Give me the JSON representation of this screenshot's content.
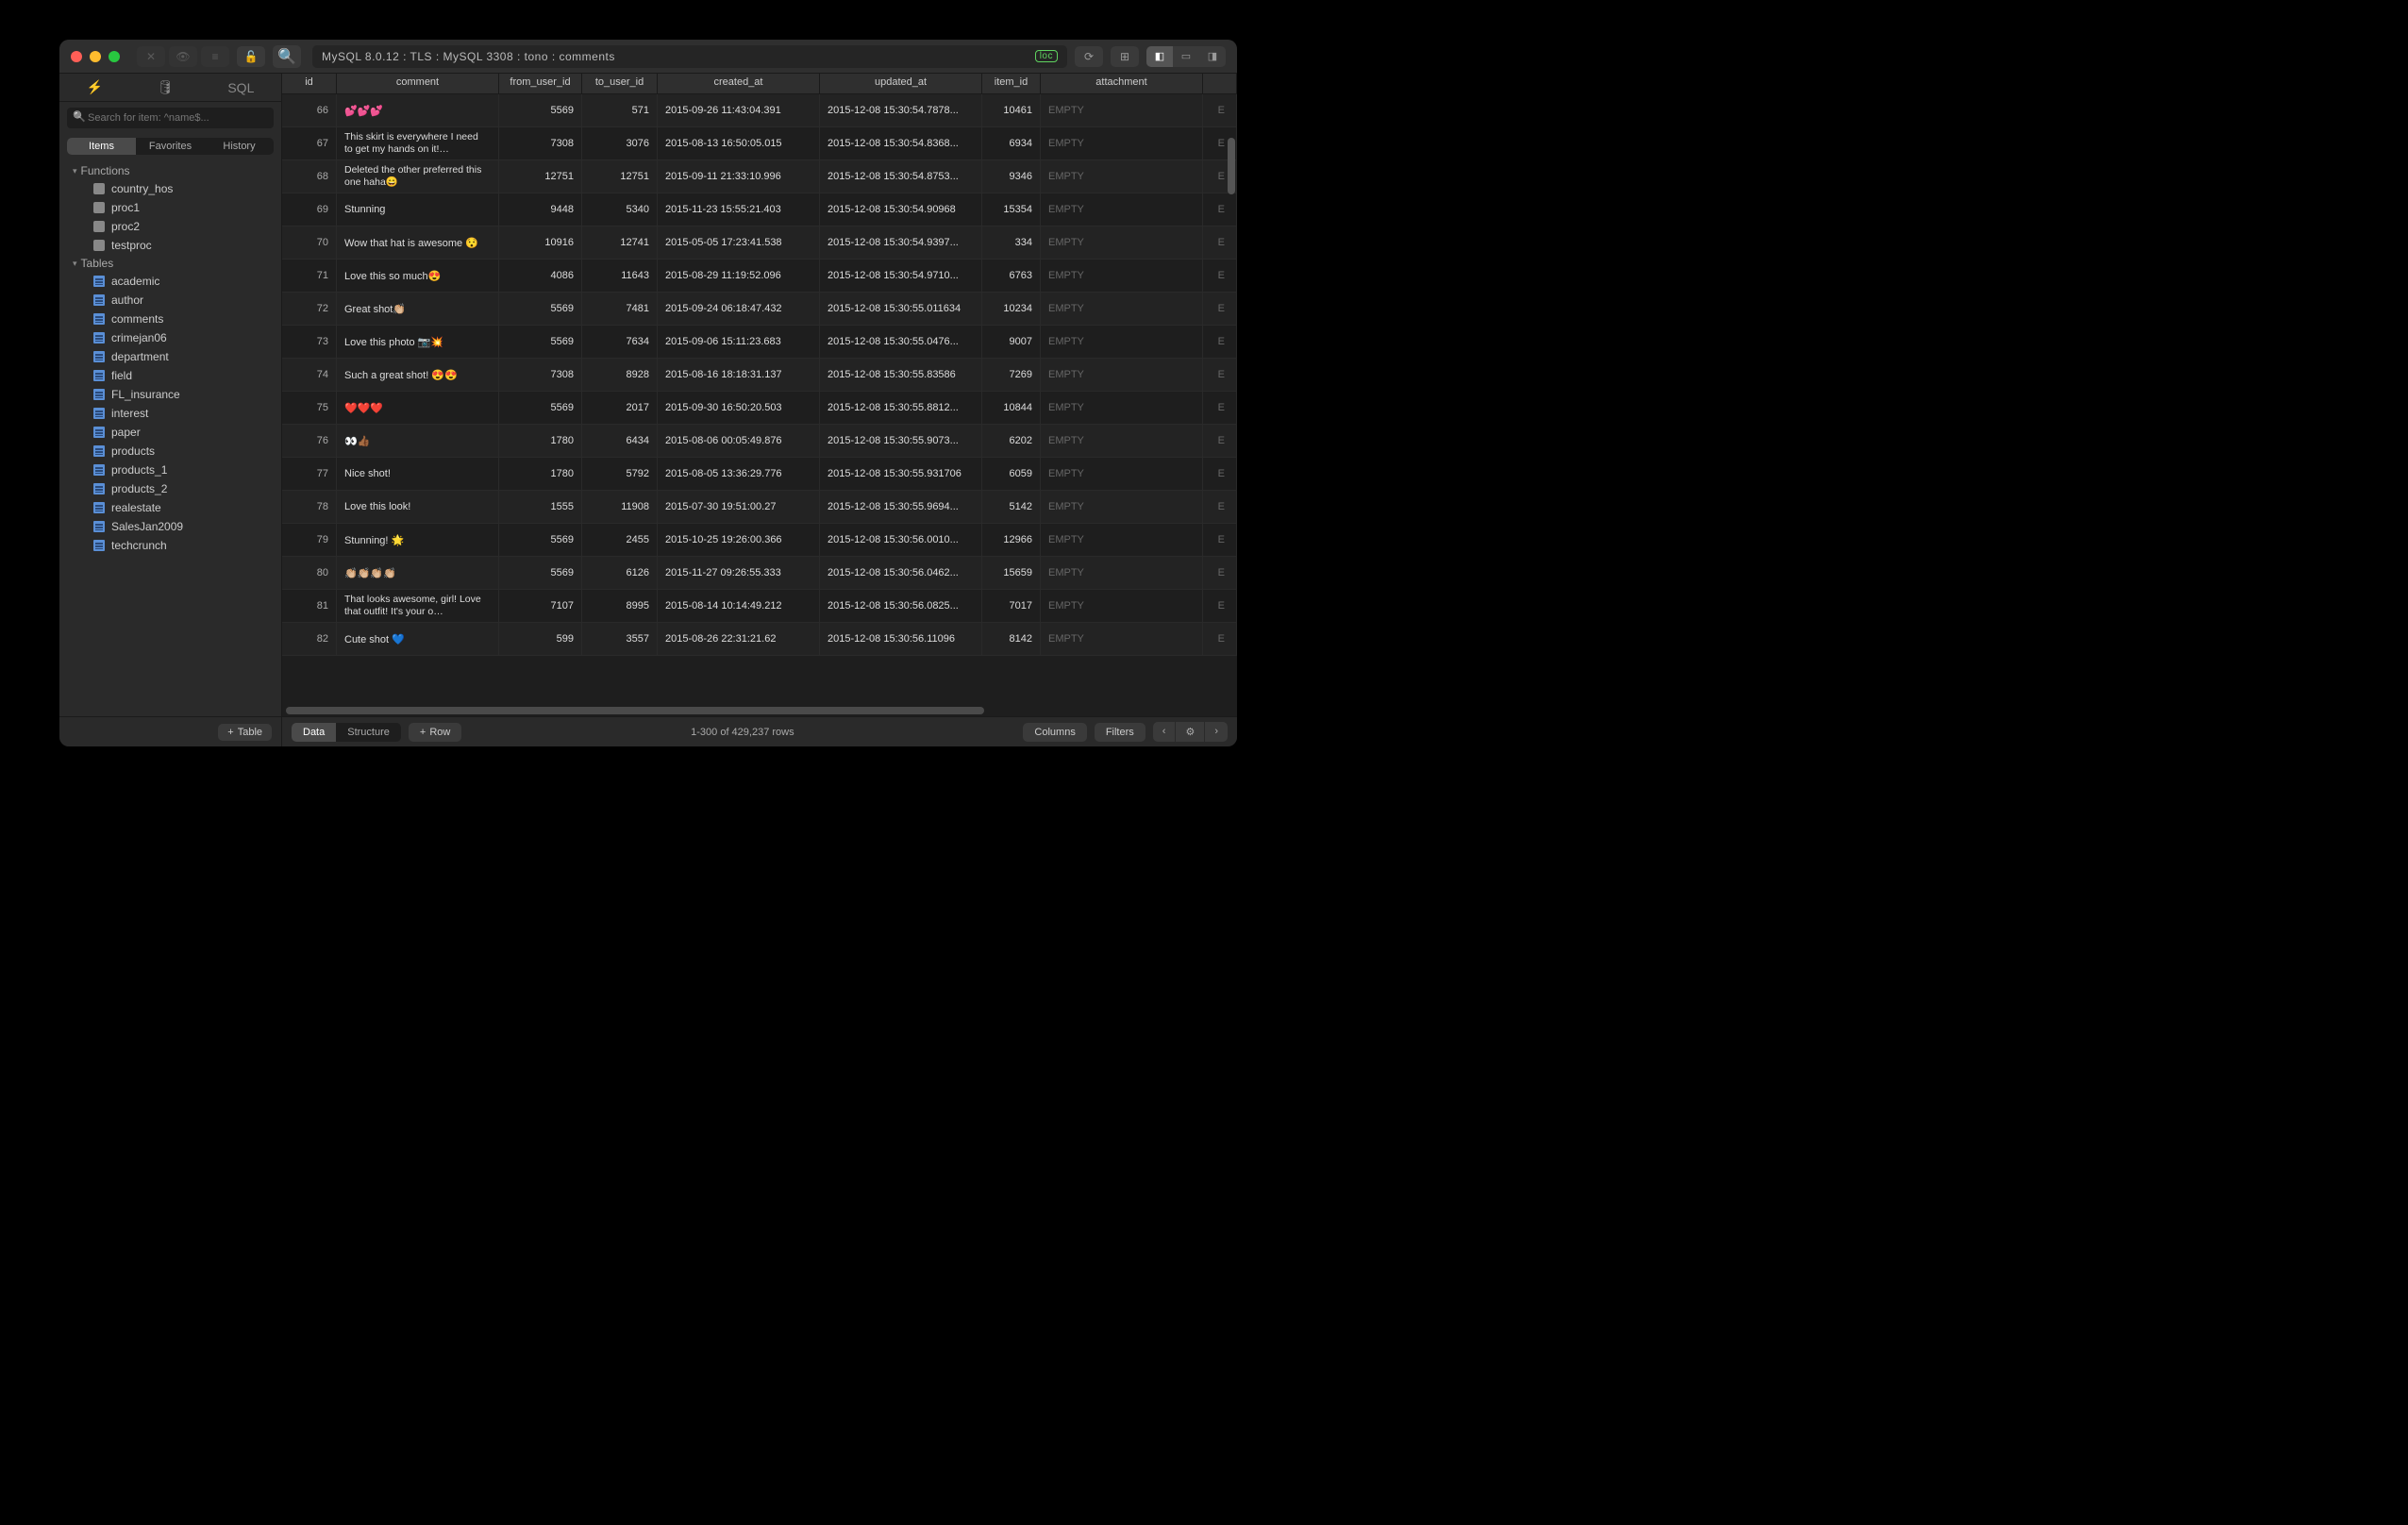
{
  "breadcrumb": "MySQL 8.0.12 : TLS : MySQL 3308 : tono : comments",
  "loc_badge": "loc",
  "search_placeholder": "Search for item: ^name$...",
  "segments": {
    "items": "Items",
    "favorites": "Favorites",
    "history": "History"
  },
  "tree": {
    "functions_label": "Functions",
    "functions": [
      "country_hos",
      "proc1",
      "proc2",
      "testproc"
    ],
    "tables_label": "Tables",
    "tables": [
      "academic",
      "author",
      "comments",
      "crimejan06",
      "department",
      "field",
      "FL_insurance",
      "interest",
      "paper",
      "products",
      "products_1",
      "products_2",
      "realestate",
      "SalesJan2009",
      "techcrunch"
    ]
  },
  "add_table_label": "Table",
  "columns": [
    "id",
    "comment",
    "from_user_id",
    "to_user_id",
    "created_at",
    "updated_at",
    "item_id",
    "attachment"
  ],
  "empty_label": "EMPTY",
  "rows": [
    {
      "id": "66",
      "comment": "💕💕💕",
      "from": "5569",
      "to": "571",
      "created": "2015-09-26 11:43:04.391",
      "updated": "2015-12-08 15:30:54.7878...",
      "item": "10461"
    },
    {
      "id": "67",
      "comment": "This skirt is everywhere I need to get my hands on it!…",
      "from": "7308",
      "to": "3076",
      "created": "2015-08-13 16:50:05.015",
      "updated": "2015-12-08 15:30:54.8368...",
      "item": "6934",
      "multi": true
    },
    {
      "id": "68",
      "comment": "Deleted the other preferred this one haha😄",
      "from": "12751",
      "to": "12751",
      "created": "2015-09-11 21:33:10.996",
      "updated": "2015-12-08 15:30:54.8753...",
      "item": "9346",
      "multi": true
    },
    {
      "id": "69",
      "comment": "Stunning",
      "from": "9448",
      "to": "5340",
      "created": "2015-11-23 15:55:21.403",
      "updated": "2015-12-08 15:30:54.90968",
      "item": "15354"
    },
    {
      "id": "70",
      "comment": "Wow that hat is awesome 😯",
      "from": "10916",
      "to": "12741",
      "created": "2015-05-05 17:23:41.538",
      "updated": "2015-12-08 15:30:54.9397...",
      "item": "334"
    },
    {
      "id": "71",
      "comment": " Love this so much😍",
      "from": "4086",
      "to": "11643",
      "created": "2015-08-29 11:19:52.096",
      "updated": "2015-12-08 15:30:54.9710...",
      "item": "6763"
    },
    {
      "id": "72",
      "comment": "Great shot👏🏼",
      "from": "5569",
      "to": "7481",
      "created": "2015-09-24 06:18:47.432",
      "updated": "2015-12-08 15:30:55.011634",
      "item": "10234"
    },
    {
      "id": "73",
      "comment": "Love this photo 📷💥",
      "from": "5569",
      "to": "7634",
      "created": "2015-09-06 15:11:23.683",
      "updated": "2015-12-08 15:30:55.0476...",
      "item": "9007"
    },
    {
      "id": "74",
      "comment": "Such a great shot! 😍😍",
      "from": "7308",
      "to": "8928",
      "created": "2015-08-16 18:18:31.137",
      "updated": "2015-12-08 15:30:55.83586",
      "item": "7269"
    },
    {
      "id": "75",
      "comment": "❤️❤️❤️",
      "from": "5569",
      "to": "2017",
      "created": "2015-09-30 16:50:20.503",
      "updated": "2015-12-08 15:30:55.8812...",
      "item": "10844"
    },
    {
      "id": "76",
      "comment": "👀👍🏾",
      "from": "1780",
      "to": "6434",
      "created": "2015-08-06 00:05:49.876",
      "updated": "2015-12-08 15:30:55.9073...",
      "item": "6202"
    },
    {
      "id": "77",
      "comment": "Nice shot!",
      "from": "1780",
      "to": "5792",
      "created": "2015-08-05 13:36:29.776",
      "updated": "2015-12-08 15:30:55.931706",
      "item": "6059"
    },
    {
      "id": "78",
      "comment": "Love this look!",
      "from": "1555",
      "to": "11908",
      "created": "2015-07-30 19:51:00.27",
      "updated": "2015-12-08 15:30:55.9694...",
      "item": "5142"
    },
    {
      "id": "79",
      "comment": "Stunning! 🌟",
      "from": "5569",
      "to": "2455",
      "created": "2015-10-25 19:26:00.366",
      "updated": "2015-12-08 15:30:56.0010...",
      "item": "12966"
    },
    {
      "id": "80",
      "comment": "👏🏼👏🏼👏🏼👏🏼",
      "from": "5569",
      "to": "6126",
      "created": "2015-11-27 09:26:55.333",
      "updated": "2015-12-08 15:30:56.0462...",
      "item": "15659"
    },
    {
      "id": "81",
      "comment": "That looks awesome, girl! Love that outfit! It's your o…",
      "from": "7107",
      "to": "8995",
      "created": "2015-08-14 10:14:49.212",
      "updated": "2015-12-08 15:30:56.0825...",
      "item": "7017",
      "multi": true
    },
    {
      "id": "82",
      "comment": "Cute shot 💙",
      "from": "599",
      "to": "3557",
      "created": "2015-08-26 22:31:21.62",
      "updated": "2015-12-08 15:30:56.11096",
      "item": "8142"
    }
  ],
  "footer": {
    "data": "Data",
    "structure": "Structure",
    "row": "Row",
    "status": "1-300 of 429,237 rows",
    "columns": "Columns",
    "filters": "Filters"
  }
}
